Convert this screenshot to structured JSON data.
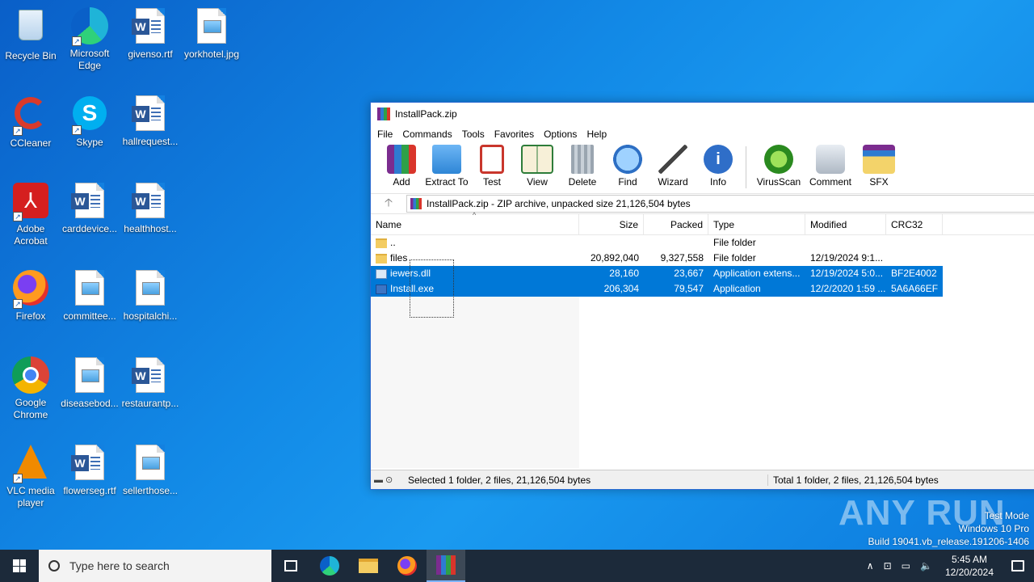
{
  "desktop": {
    "icons": [
      {
        "label": "Recycle Bin"
      },
      {
        "label": "Microsoft Edge"
      },
      {
        "label": "givenso.rtf"
      },
      {
        "label": "yorkhotel.jpg"
      },
      {
        "label": "CCleaner"
      },
      {
        "label": "Skype"
      },
      {
        "label": "hallrequest..."
      },
      {
        "label": "Adobe Acrobat"
      },
      {
        "label": "carddevice..."
      },
      {
        "label": "healthhost..."
      },
      {
        "label": "Firefox"
      },
      {
        "label": "committee..."
      },
      {
        "label": "hospitalchi..."
      },
      {
        "label": "Google Chrome"
      },
      {
        "label": "diseasebod..."
      },
      {
        "label": "restaurantp..."
      },
      {
        "label": "VLC media player"
      },
      {
        "label": "flowerseg.rtf"
      },
      {
        "label": "sellerthose..."
      }
    ]
  },
  "window": {
    "title": "InstallPack.zip",
    "menu": [
      "File",
      "Commands",
      "Tools",
      "Favorites",
      "Options",
      "Help"
    ],
    "toolbar": [
      "Add",
      "Extract To",
      "Test",
      "View",
      "Delete",
      "Find",
      "Wizard",
      "Info",
      "VirusScan",
      "Comment",
      "SFX"
    ],
    "address": "InstallPack.zip - ZIP archive, unpacked size 21,126,504 bytes",
    "columns": [
      "Name",
      "Size",
      "Packed",
      "Type",
      "Modified",
      "CRC32"
    ],
    "rows": [
      {
        "name": "..",
        "size": "",
        "packed": "",
        "type": "File folder",
        "modified": "",
        "crc": "",
        "icon": "folder",
        "selected": false
      },
      {
        "name": "files",
        "size": "20,892,040",
        "packed": "9,327,558",
        "type": "File folder",
        "modified": "12/19/2024 9:1...",
        "crc": "",
        "icon": "folder",
        "selected": false
      },
      {
        "name": "iewers.dll",
        "size": "28,160",
        "packed": "23,667",
        "type": "Application extens...",
        "modified": "12/19/2024 5:0...",
        "crc": "BF2E4002",
        "icon": "dll",
        "selected": true
      },
      {
        "name": "Install.exe",
        "size": "206,304",
        "packed": "79,547",
        "type": "Application",
        "modified": "12/2/2020 1:59 ...",
        "crc": "5A6A66EF",
        "icon": "exe",
        "selected": true
      }
    ],
    "status_left": "Selected 1 folder, 2 files, 21,126,504 bytes",
    "status_right": "Total 1 folder, 2 files, 21,126,504 bytes"
  },
  "watermark": {
    "logo": "ANY RUN",
    "line1": "Test Mode",
    "line2": "Windows 10 Pro",
    "line3": "Build 19041.vb_release.191206-1406"
  },
  "taskbar": {
    "search_placeholder": "Type here to search",
    "time": "5:45 AM",
    "date": "12/20/2024"
  }
}
